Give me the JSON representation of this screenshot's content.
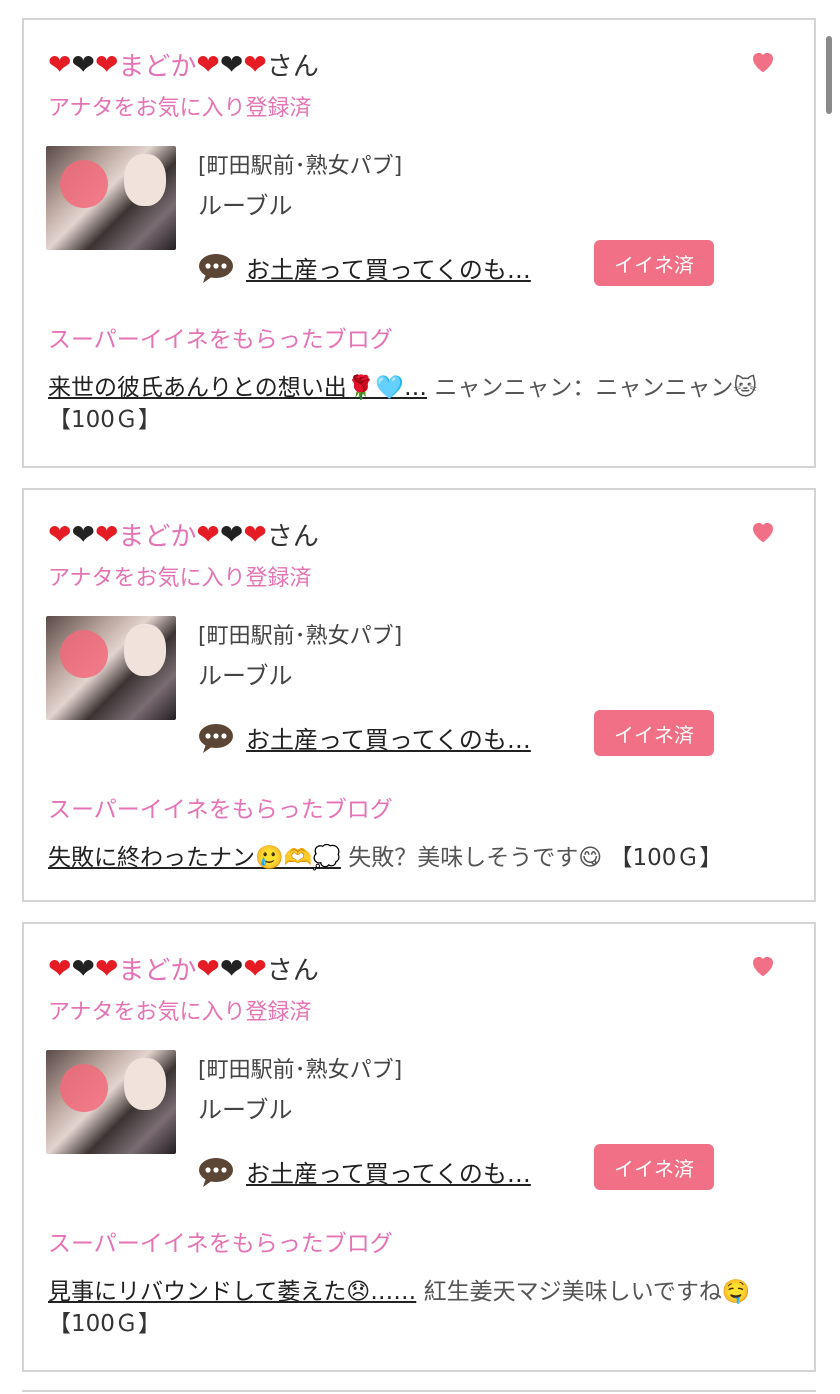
{
  "cards": [
    {
      "name_prefix_hearts": [
        "red",
        "black",
        "red"
      ],
      "name_text": "まどか",
      "name_suffix_hearts": [
        "red",
        "black",
        "red"
      ],
      "name_honorific": "さん",
      "status": "アナタをお気に入り登録済",
      "shop_category": "[町田駅前･熟女パブ]",
      "shop_name": "ルーブル",
      "message": "お土産って買ってくのも…",
      "iine_label": "イイネ済",
      "section_title": "スーパーイイネをもらったブログ",
      "blog_title": "来世の彼氏あんりとの想い出🌹🩵…",
      "blog_comment": "ニャンニャン：ニャンニャン🐱",
      "blog_price": "【100Ｇ】"
    },
    {
      "name_prefix_hearts": [
        "red",
        "black",
        "red"
      ],
      "name_text": "まどか",
      "name_suffix_hearts": [
        "red",
        "black",
        "red"
      ],
      "name_honorific": "さん",
      "status": "アナタをお気に入り登録済",
      "shop_category": "[町田駅前･熟女パブ]",
      "shop_name": "ルーブル",
      "message": "お土産って買ってくのも…",
      "iine_label": "イイネ済",
      "section_title": "スーパーイイネをもらったブログ",
      "blog_title": "失敗に終わったナン🥲🫶💭",
      "blog_comment": "失敗？美味しそうです😋",
      "blog_price": "【100Ｇ】"
    },
    {
      "name_prefix_hearts": [
        "red",
        "black",
        "red"
      ],
      "name_text": "まどか",
      "name_suffix_hearts": [
        "red",
        "black",
        "red"
      ],
      "name_honorific": "さん",
      "status": "アナタをお気に入り登録済",
      "shop_category": "[町田駅前･熟女パブ]",
      "shop_name": "ルーブル",
      "message": "お土産って買ってくのも…",
      "iine_label": "イイネ済",
      "section_title": "スーパーイイネをもらったブログ",
      "blog_title": "見事にリバウンドして萎えた😞……",
      "blog_comment": "紅生姜天マジ美味しいですね🤤",
      "blog_price": "【100Ｇ】"
    }
  ],
  "colors": {
    "accent_pink": "#e573b5",
    "button_pink": "#f27085",
    "border": "#d4d4d4"
  },
  "icons": [
    "favorite-heart-icon",
    "chat-bubble-icon"
  ]
}
